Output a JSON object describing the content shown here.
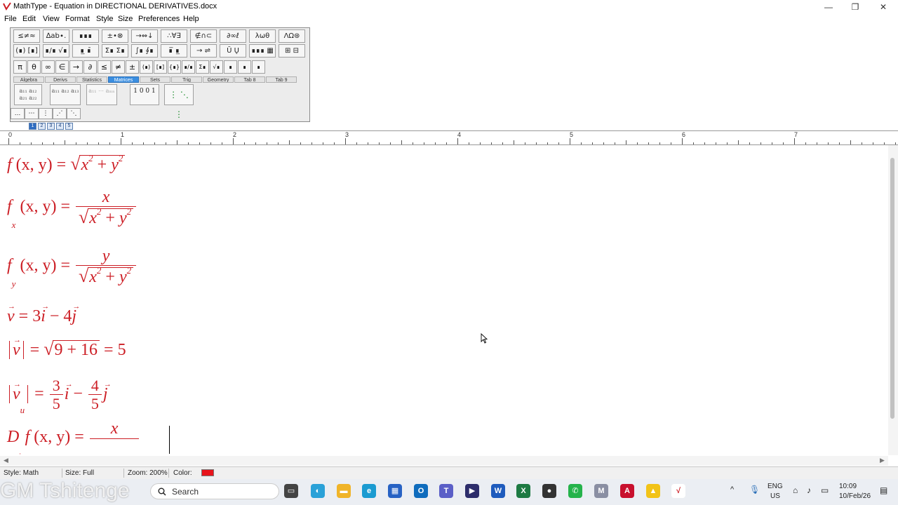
{
  "window": {
    "title": "MathType - Equation in DIRECTIONAL DERIVATIVES.docx",
    "controls": [
      "—",
      "❐",
      "✕"
    ]
  },
  "menu": [
    "File",
    "Edit",
    "View",
    "Format",
    "Style",
    "Size",
    "Preferences",
    "Help"
  ],
  "palette": {
    "row1": [
      "≤≠≈",
      "∆ab∙.",
      "∎∎∎",
      "±•⊗",
      "→⇔↓",
      "∴∀∃",
      "∉∩⊂",
      "∂∞ℓ",
      "λωθ",
      "ΛΩ⊛"
    ],
    "row2": [
      "(∎) [∎]",
      "∎/∎ √∎",
      "∎̲ ∎̄",
      "Σ∎ Σ∎",
      "∫∎ ∮∎",
      "∎̅ ∎̲",
      "→ ⇌",
      "Ū Ų",
      "∎∎∎ ▦",
      "⊞ ⊟"
    ],
    "symbols": [
      "π",
      "θ",
      "∞",
      "∈",
      "→",
      "∂",
      "≤",
      "≠",
      "±",
      "(∎)",
      "[∎]",
      "{∎}",
      "∎/∎",
      "Σ∎",
      "√∎",
      "∎",
      "∎",
      "∎"
    ],
    "tabs": [
      "Algebra",
      "Derivs",
      "Statistics",
      "Matrices",
      "Sets",
      "Trig",
      "Geometry",
      "Tab 8",
      "Tab 9"
    ],
    "active_tab": "Matrices",
    "matrix_templates": [
      "a₁₁ a₁₂ a₂₁ a₂₂",
      "a₁₁ a₁₂ a₁₃",
      "a₁₁ ⋯ aₘₙ",
      "1 0 0 1",
      "⋮ ⋱ ⋮"
    ],
    "dots": [
      "…",
      "⋯",
      "⋮",
      "⋰",
      "⋱"
    ],
    "mini_icons": [
      "1",
      "2",
      "3",
      "4",
      "5"
    ]
  },
  "ruler": {
    "labels": [
      "0",
      "1",
      "2",
      "3",
      "4",
      "5",
      "6",
      "7"
    ]
  },
  "equations": {
    "eq1": {
      "lhs": "f",
      "args": "(x, y)",
      "eq": "=",
      "rad": "x",
      "exp1": "2",
      "plus": "+",
      "rad2": "y",
      "exp2": "2"
    },
    "eq2": {
      "lhs": "f",
      "sub": "x",
      "args": "(x, y)",
      "eq": "=",
      "num": "x",
      "rad": "x",
      "exp1": "2",
      "plus": "+",
      "rad2": "y",
      "exp2": "2"
    },
    "eq3": {
      "lhs": "f",
      "sub": "y",
      "args": "(x, y)",
      "eq": "=",
      "num": "y",
      "rad": "x",
      "exp1": "2",
      "plus": "+",
      "rad2": "y",
      "exp2": "2"
    },
    "eq4": {
      "v": "v",
      "eq": "=",
      "c1": "3",
      "i": "i",
      "minus": "−",
      "c2": "4",
      "j": "j"
    },
    "eq5": {
      "v": "v",
      "eq": "=",
      "rad": "9 + 16",
      "eq2": "=",
      "result": "5"
    },
    "eq6": {
      "v": "v",
      "sub": "u",
      "eq": "=",
      "n1": "3",
      "d1": "5",
      "i": "i",
      "minus": "−",
      "n2": "4",
      "d2": "5",
      "j": "j"
    },
    "eq7": {
      "d": "D",
      "f": "f",
      "args": "(x, y)",
      "eq": "=",
      "num": "x"
    }
  },
  "status": {
    "style": "Style: Math",
    "size": "Size: Full",
    "zoom": "Zoom: 200%",
    "color_label": "Color:",
    "color": "#e8141b"
  },
  "taskbar": {
    "watermark": "GM Tshitenge",
    "search_placeholder": "Search",
    "lang": "ENG",
    "region": "US",
    "time": "10:09",
    "date": "10/Feb/26"
  }
}
